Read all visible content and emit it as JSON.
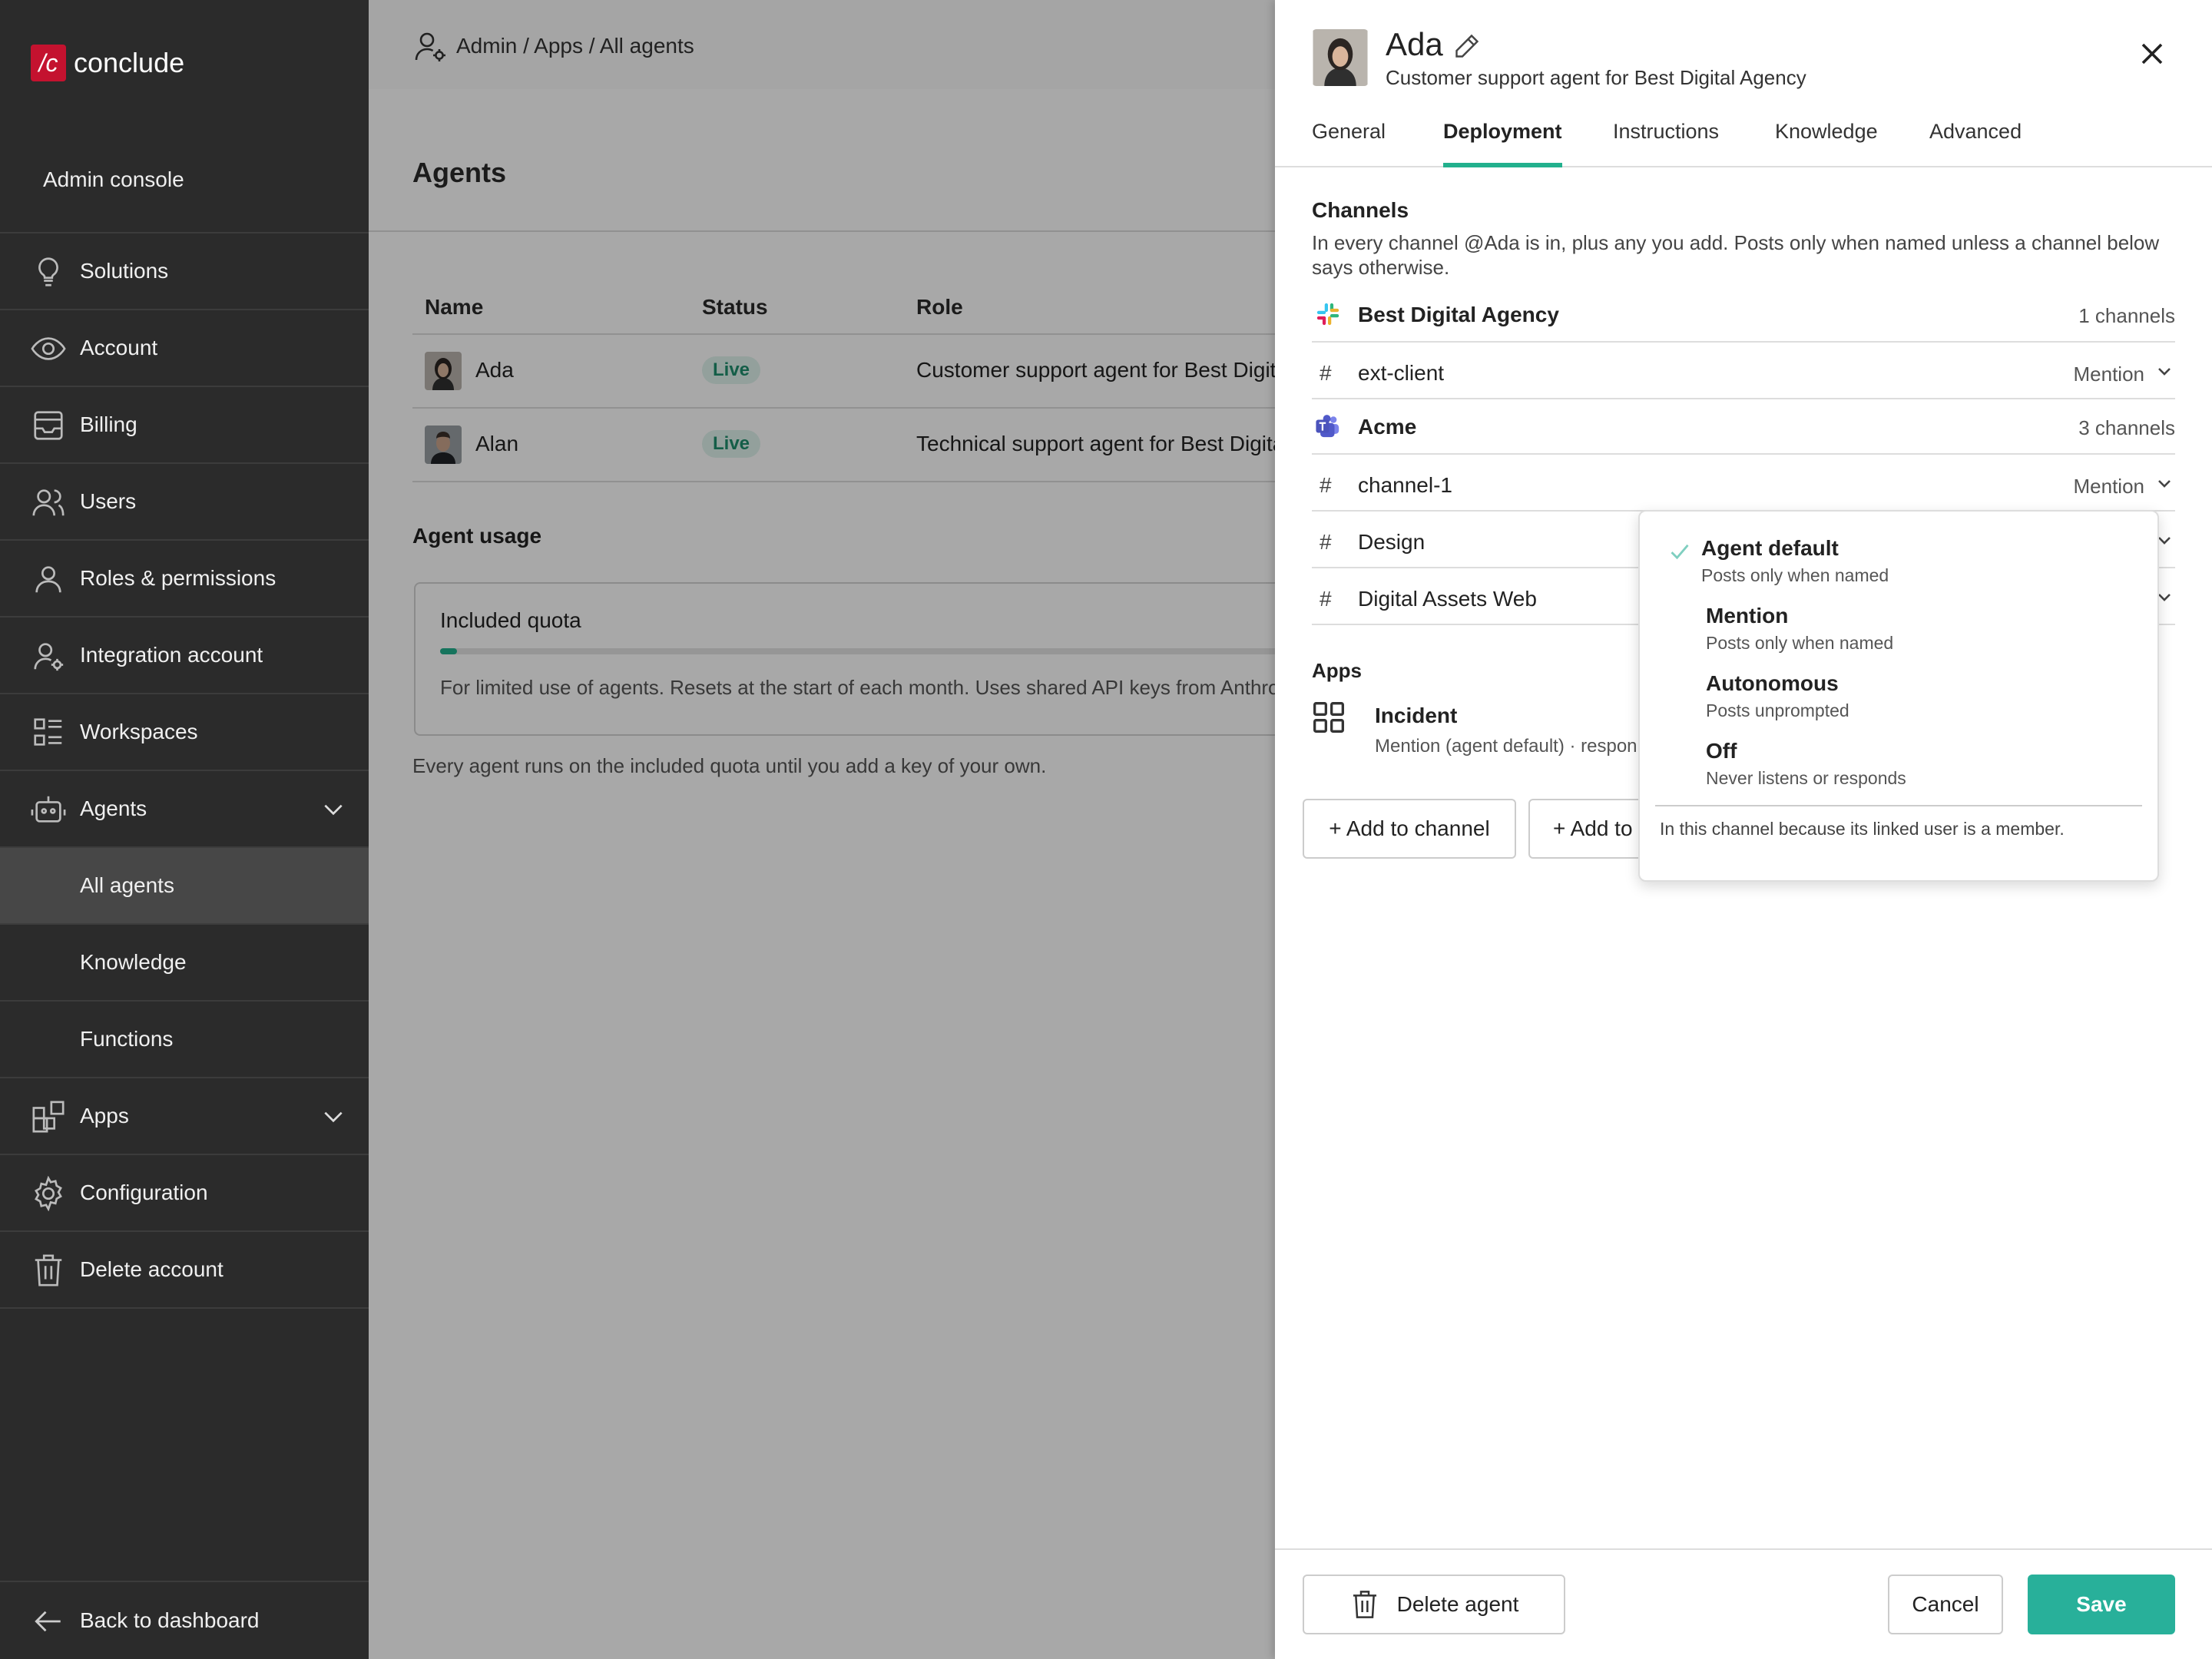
{
  "brand": {
    "logo_mark": "/c",
    "name": "conclude"
  },
  "sidebar": {
    "heading": "Admin console",
    "items": [
      {
        "label": "Solutions",
        "icon": "lightbulb-icon"
      },
      {
        "label": "Account",
        "icon": "eye-icon"
      },
      {
        "label": "Billing",
        "icon": "inbox-icon"
      },
      {
        "label": "Users",
        "icon": "users-icon"
      },
      {
        "label": "Roles & permissions",
        "icon": "user-icon"
      },
      {
        "label": "Integration account",
        "icon": "user-gear-icon"
      },
      {
        "label": "Workspaces",
        "icon": "list-icon"
      },
      {
        "label": "Agents",
        "icon": "robot-icon",
        "expanded": true
      },
      {
        "label": "All agents",
        "sub": true,
        "active": true
      },
      {
        "label": "Knowledge",
        "sub": true
      },
      {
        "label": "Functions",
        "sub": true
      },
      {
        "label": "Apps",
        "icon": "apps-icon",
        "expanded": true
      },
      {
        "label": "Configuration",
        "icon": "gear-icon"
      },
      {
        "label": "Delete account",
        "icon": "trash-icon"
      }
    ],
    "back": "Back to dashboard"
  },
  "main": {
    "breadcrumb": "Admin / Apps / All agents",
    "title": "Agents",
    "table": {
      "headers": [
        "Name",
        "Status",
        "Role"
      ],
      "rows": [
        {
          "name": "Ada",
          "status": "Live",
          "role": "Customer support agent for Best Digital Agency"
        },
        {
          "name": "Alan",
          "status": "Live",
          "role": "Technical support agent for Best Digital Agency"
        }
      ]
    },
    "usage": {
      "title": "Agent usage",
      "quota_label": "Included quota",
      "quota_fraction": 0.02,
      "description": "For limited use of agents. Resets at the start of each month. Uses shared API keys from Anthropic.",
      "note": "Every agent runs on the included quota until you add a key of your own."
    }
  },
  "drawer": {
    "name": "Ada",
    "subtitle": "Customer support agent for Best Digital Agency",
    "tabs": [
      "General",
      "Deployment",
      "Instructions",
      "Knowledge",
      "Advanced"
    ],
    "active_tab": "Deployment",
    "channels": {
      "title": "Channels",
      "description": "In every channel @Ada is in, plus any you add. Posts only when named unless a channel below says otherwise.",
      "workspaces": [
        {
          "name": "Best Digital Agency",
          "count": "1 channels",
          "icon": "slack-icon",
          "channels": [
            {
              "name": "ext-client",
              "mode": "Mention"
            }
          ]
        },
        {
          "name": "Acme",
          "count": "3 channels",
          "icon": "teams-icon",
          "channels": [
            {
              "name": "channel-1",
              "mode": "Mention"
            },
            {
              "name": "Design",
              "mode": ""
            },
            {
              "name": "Digital Assets Web",
              "mode": ""
            }
          ]
        }
      ]
    },
    "apps": {
      "title": "Apps",
      "items": [
        {
          "name": "Incident",
          "mode": "Mention (agent default) · responds"
        }
      ]
    },
    "buttons": {
      "add_channel": "+ Add to channel",
      "add_to": "+ Add to"
    },
    "footer": {
      "delete": "Delete agent",
      "cancel": "Cancel",
      "save": "Save"
    }
  },
  "mode_menu": {
    "options": [
      {
        "label": "Agent default",
        "desc": "Posts only when named",
        "selected": true
      },
      {
        "label": "Mention",
        "desc": "Posts only when named",
        "selected": false
      },
      {
        "label": "Autonomous",
        "desc": "Posts unprompted",
        "selected": false
      },
      {
        "label": "Off",
        "desc": "Never listens or responds",
        "selected": false
      }
    ],
    "note": "In this channel because its linked user is a member."
  },
  "colors": {
    "accent": "#28b09a",
    "brand": "#c4122f",
    "sidebar": "#2b2b2b"
  }
}
